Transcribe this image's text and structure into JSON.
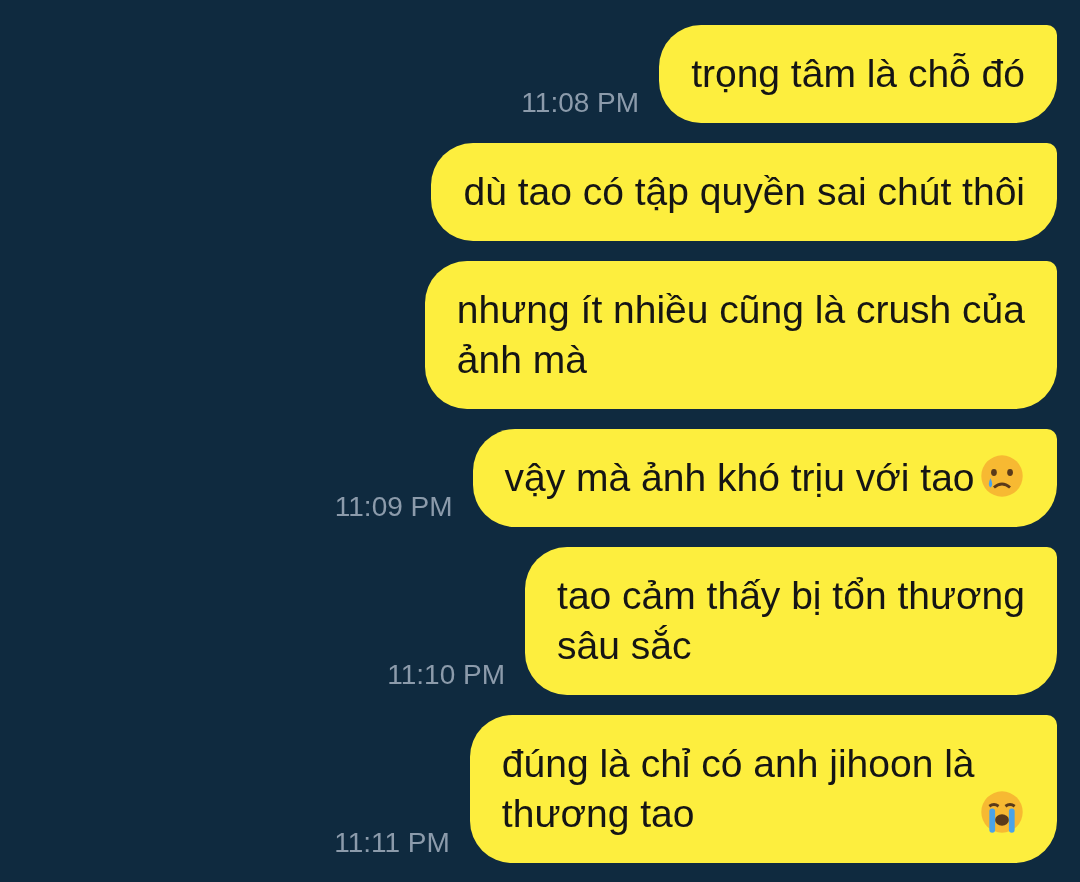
{
  "messages": [
    {
      "kind": "plain",
      "text": "trọng tâm là chỗ đó",
      "time": "11:08 PM"
    },
    {
      "kind": "plain",
      "text": "dù tao có tập quyền sai chút thôi"
    },
    {
      "kind": "plain",
      "text": "nhưng ít nhiều cũng là crush của\nảnh mà"
    },
    {
      "kind": "crying_emoji",
      "text": "vậy mà ảnh khó trịu với tao",
      "time": "11:09 PM"
    },
    {
      "kind": "plain",
      "text": "tao cảm thấy bị tổn thương\nsâu sắc",
      "time": "11:10 PM"
    },
    {
      "kind": "sobbing_emoji",
      "text": "đúng là chỉ có anh jihoon là\nthương tao",
      "time": "11:11 PM"
    }
  ]
}
